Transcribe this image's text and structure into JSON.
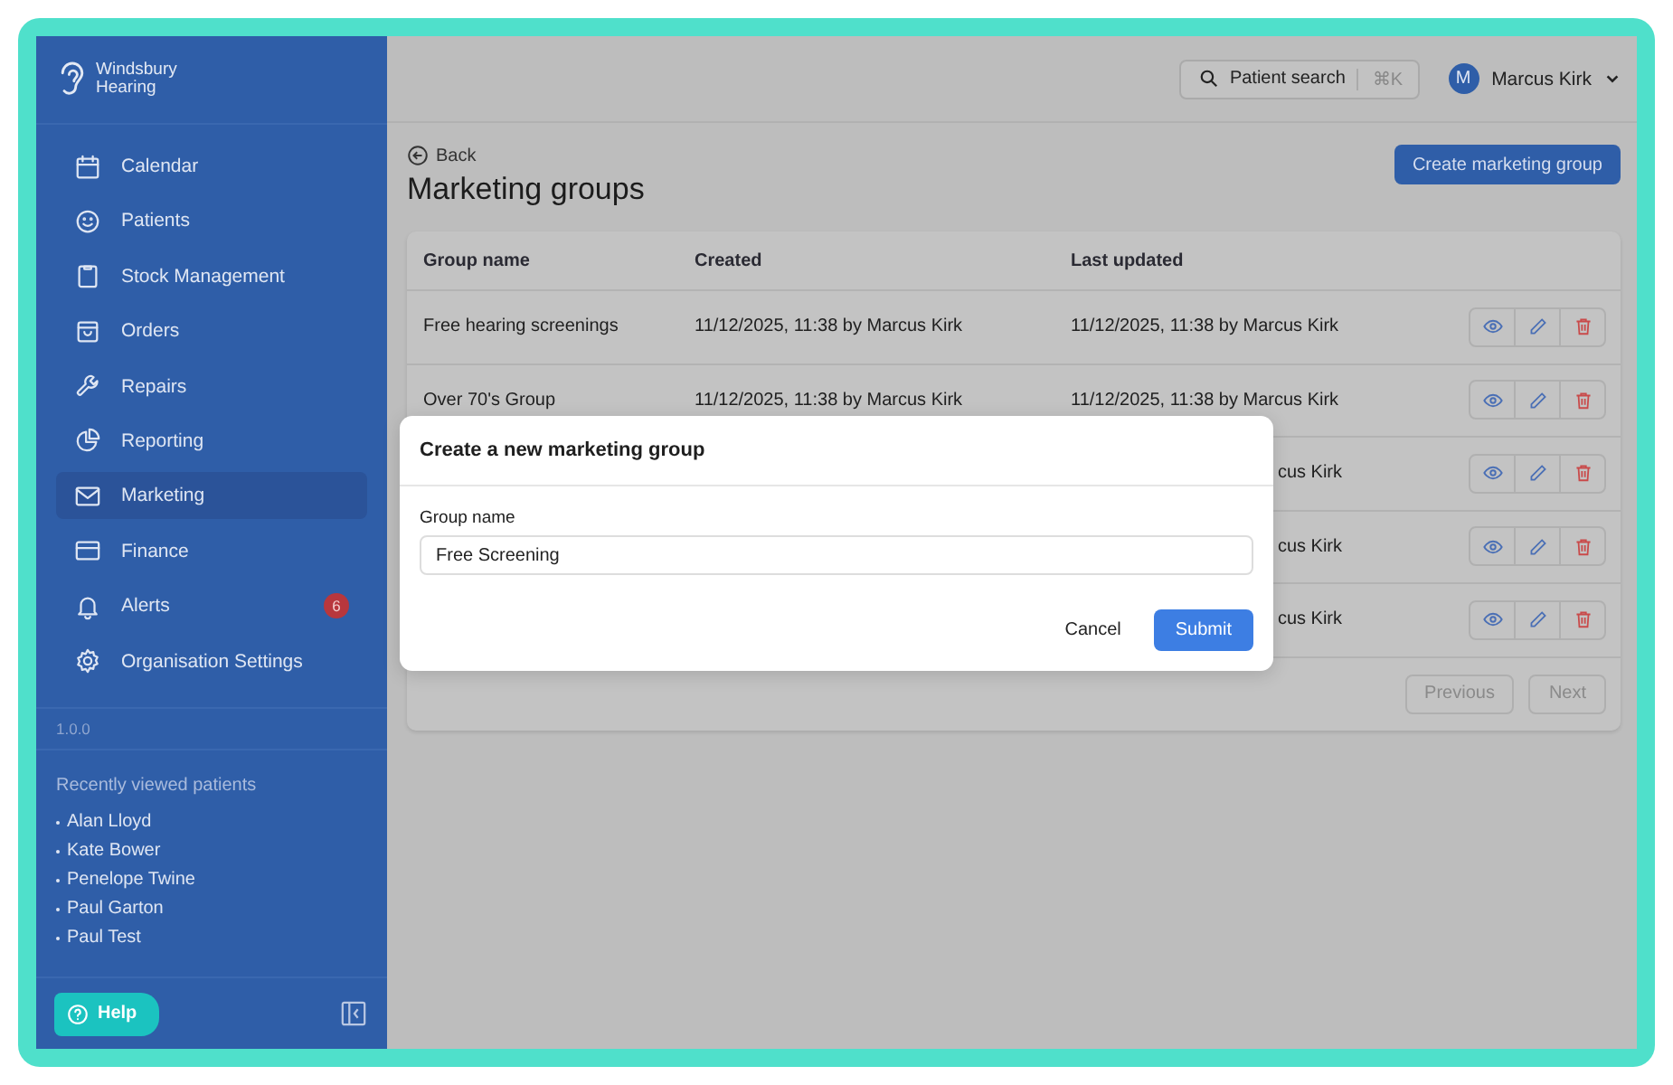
{
  "brand": {
    "name_line1": "Windsbury",
    "name_line2": "Hearing"
  },
  "sidebar": {
    "items": [
      {
        "label": "Calendar",
        "selected": false
      },
      {
        "label": "Patients",
        "selected": false
      },
      {
        "label": "Stock Management",
        "selected": false
      },
      {
        "label": "Orders",
        "selected": false
      },
      {
        "label": "Repairs",
        "selected": false
      },
      {
        "label": "Reporting",
        "selected": false
      },
      {
        "label": "Marketing",
        "selected": true
      },
      {
        "label": "Finance",
        "selected": false
      },
      {
        "label": "Alerts",
        "selected": false,
        "badge": "6"
      },
      {
        "label": "Organisation Settings",
        "selected": false
      }
    ],
    "version": "1.0.0",
    "recent_title": "Recently viewed patients",
    "recent_patients": [
      "Alan Lloyd",
      "Kate Bower",
      "Penelope Twine",
      "Paul Garton",
      "Paul Test"
    ],
    "help_button": "Help"
  },
  "top_bar": {
    "search_label": "Patient search",
    "shortcut": "⌘K",
    "avatar_initial": "M",
    "user_name": "Marcus Kirk"
  },
  "header": {
    "back_label": "Back",
    "title": "Marketing groups",
    "create_button": "Create marketing group"
  },
  "table": {
    "columns": [
      "Group name",
      "Created",
      "Last updated"
    ],
    "rows": [
      {
        "group_name": "Free hearing screenings",
        "created": "11/12/2025, 11:38 by Marcus Kirk",
        "last_updated": "11/12/2025, 11:38 by Marcus Kirk"
      },
      {
        "group_name": "Over 70's Group",
        "created": "11/12/2025, 11:38 by Marcus Kirk",
        "last_updated": "11/12/2025, 11:38 by Marcus Kirk"
      },
      {
        "last_updated": "cus Kirk"
      },
      {
        "last_updated": "cus Kirk"
      },
      {
        "last_updated": "cus Kirk"
      }
    ],
    "pagination": [
      {
        "label": "Previous",
        "disabled": true
      },
      {
        "label": "Next",
        "disabled": true
      }
    ]
  },
  "modal": {
    "title": "Create a new marketing group",
    "field_label": "Group name",
    "field_value": "Free Screening",
    "cancel_button": "Cancel",
    "submit_button": "Submit"
  }
}
